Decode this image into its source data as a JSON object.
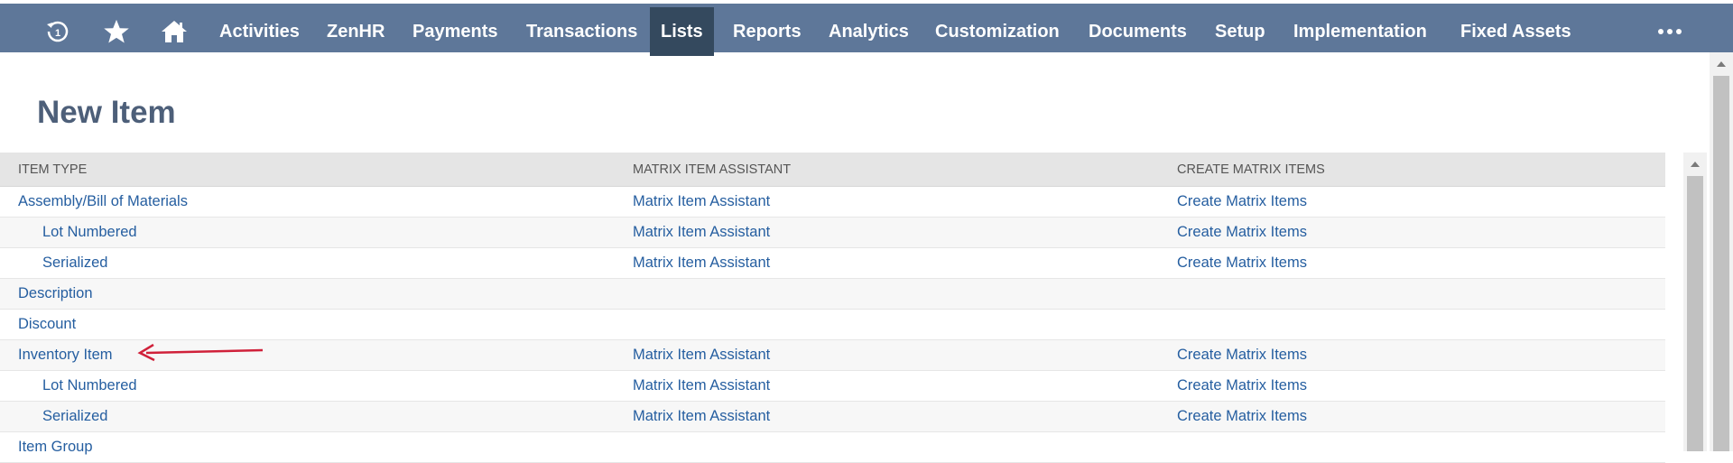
{
  "navbar": {
    "icons": [
      {
        "name": "recent-icon"
      },
      {
        "name": "star-icon"
      },
      {
        "name": "home-icon"
      }
    ],
    "items": [
      {
        "label": "Activities"
      },
      {
        "label": "ZenHR"
      },
      {
        "label": "Payments"
      },
      {
        "label": "Transactions"
      },
      {
        "label": "Lists",
        "active": true
      },
      {
        "label": "Reports"
      },
      {
        "label": "Analytics"
      },
      {
        "label": "Customization"
      },
      {
        "label": "Documents"
      },
      {
        "label": "Setup"
      },
      {
        "label": "Implementation"
      },
      {
        "label": "Fixed Assets"
      }
    ],
    "more_icon": "more-horizontal-icon",
    "bg_color": "#5e7799",
    "active_color": "#34495e"
  },
  "page": {
    "title": "New Item"
  },
  "table": {
    "headers": {
      "item_type": "ITEM TYPE",
      "matrix_assistant": "MATRIX ITEM ASSISTANT",
      "create_matrix": "CREATE MATRIX ITEMS"
    },
    "rows": [
      {
        "item_type": "Assembly/Bill of Materials",
        "indent": false,
        "matrix_assistant": "Matrix Item Assistant",
        "create_matrix": "Create Matrix Items"
      },
      {
        "item_type": "Lot Numbered",
        "indent": true,
        "matrix_assistant": "Matrix Item Assistant",
        "create_matrix": "Create Matrix Items"
      },
      {
        "item_type": "Serialized",
        "indent": true,
        "matrix_assistant": "Matrix Item Assistant",
        "create_matrix": "Create Matrix Items"
      },
      {
        "item_type": "Description",
        "indent": false,
        "matrix_assistant": "",
        "create_matrix": ""
      },
      {
        "item_type": "Discount",
        "indent": false,
        "matrix_assistant": "",
        "create_matrix": ""
      },
      {
        "item_type": "Inventory Item",
        "indent": false,
        "matrix_assistant": "Matrix Item Assistant",
        "create_matrix": "Create Matrix Items"
      },
      {
        "item_type": "Lot Numbered",
        "indent": true,
        "matrix_assistant": "Matrix Item Assistant",
        "create_matrix": "Create Matrix Items"
      },
      {
        "item_type": "Serialized",
        "indent": true,
        "matrix_assistant": "Matrix Item Assistant",
        "create_matrix": "Create Matrix Items"
      },
      {
        "item_type": "Item Group",
        "indent": false,
        "matrix_assistant": "",
        "create_matrix": ""
      }
    ],
    "link_color": "#255ea0"
  },
  "annotation": {
    "arrow_color": "#d0213a"
  }
}
